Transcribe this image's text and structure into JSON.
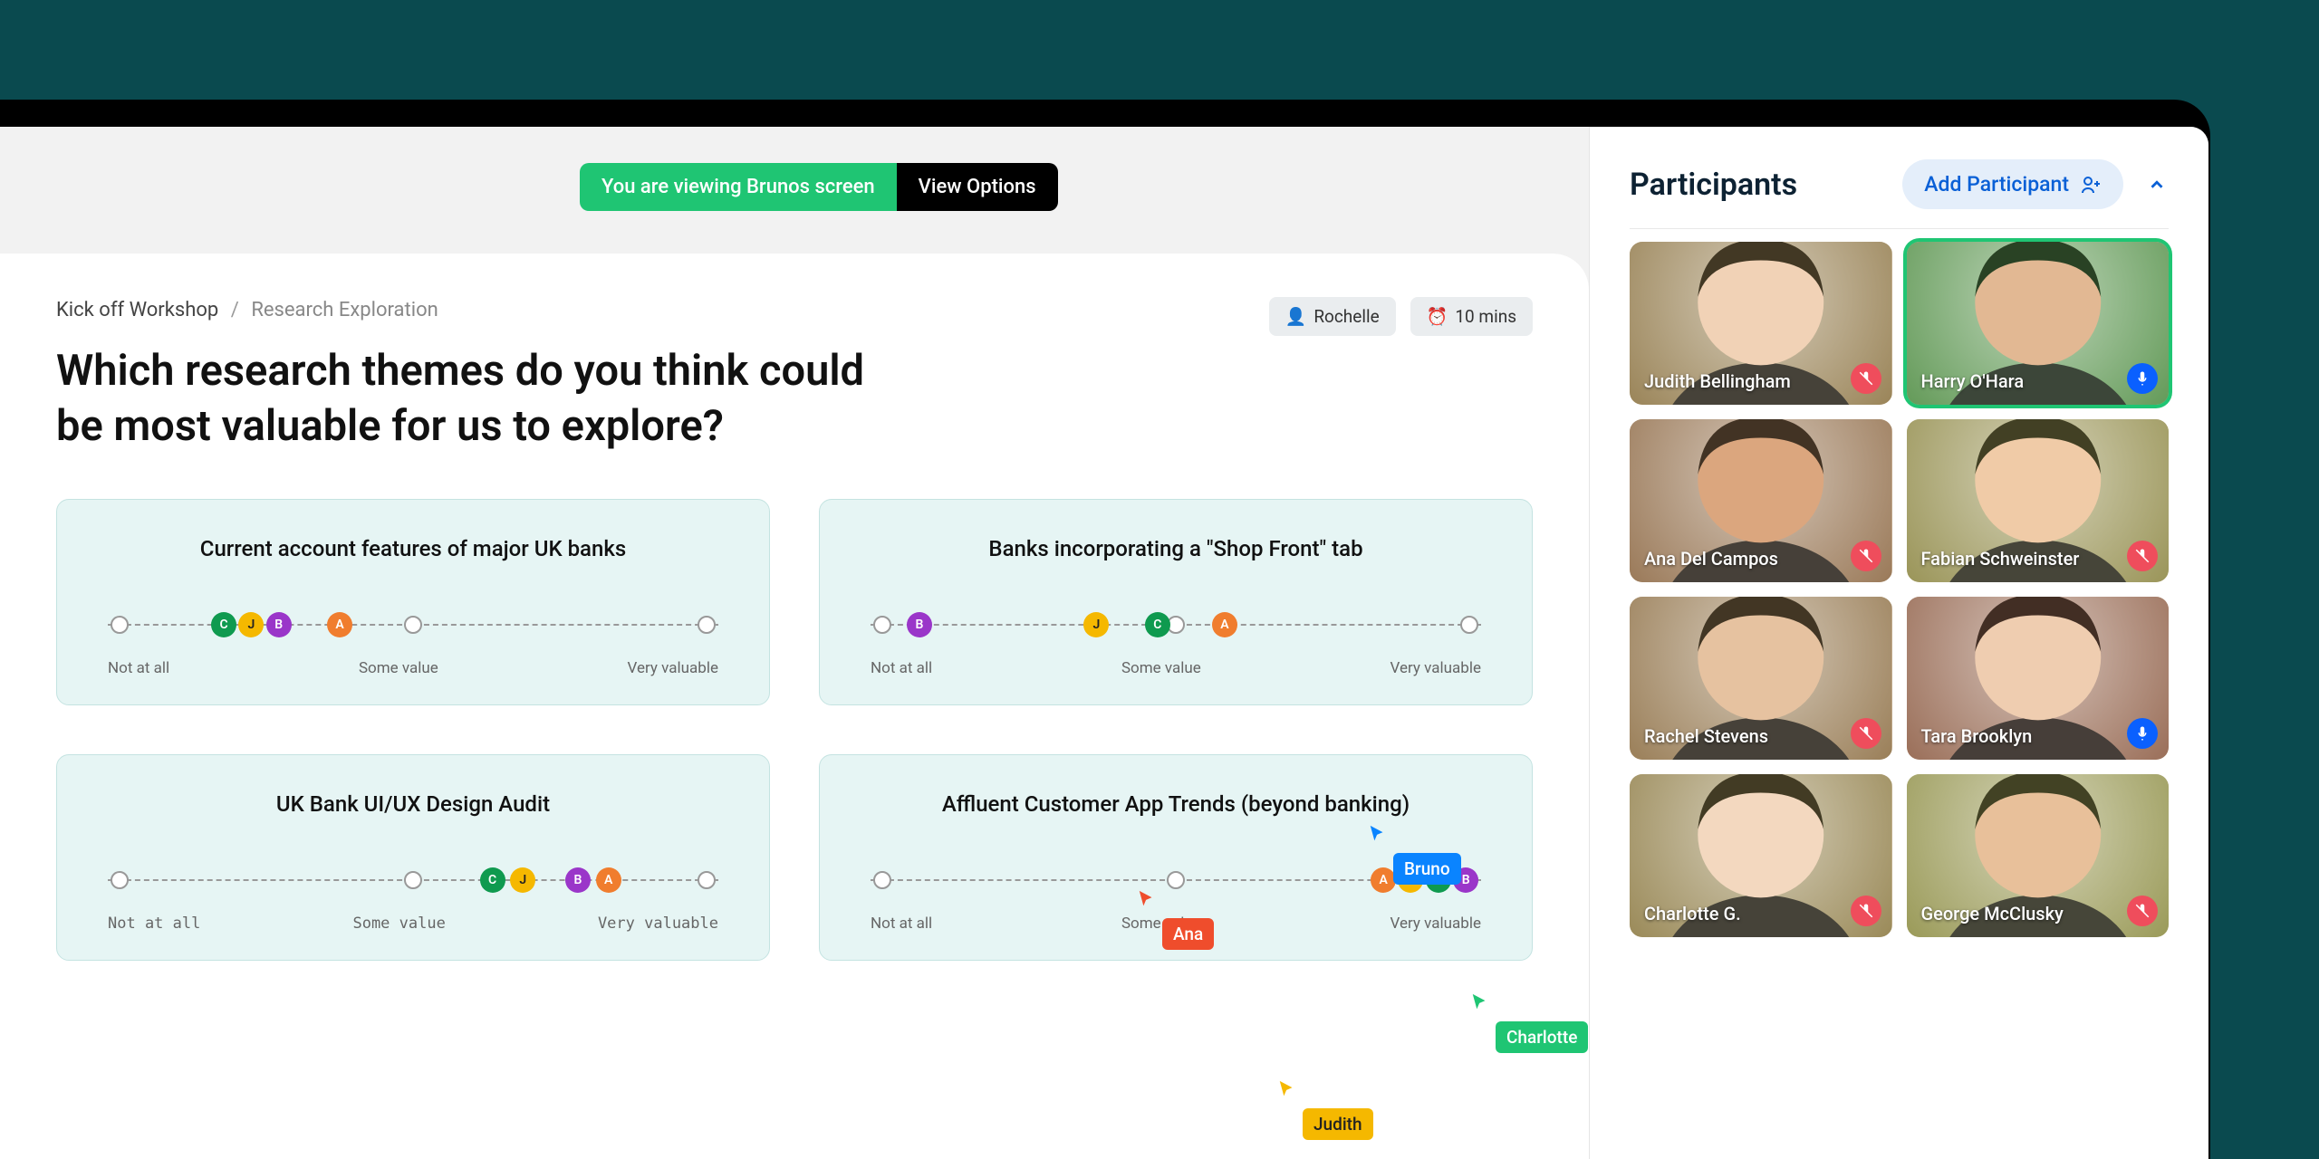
{
  "banner": {
    "viewing_text": "You are viewing Brunos screen",
    "options_label": "View Options"
  },
  "breadcrumb": {
    "parent": "Kick off Workshop",
    "current": "Research Exploration"
  },
  "meta": {
    "assignee": "Rochelle",
    "timer": "10 mins"
  },
  "page_title": "Which research themes do you think could be most valuable for us to explore?",
  "slider_label_low": "Not at all",
  "slider_label_mid": "Some value",
  "slider_label_high": "Very valuable",
  "themes": [
    {
      "title": "Current account features of major UK banks",
      "mono_labels": false,
      "dots": [
        {
          "letter": "C",
          "pos": 19
        },
        {
          "letter": "J",
          "pos": 23.5
        },
        {
          "letter": "B",
          "pos": 28
        },
        {
          "letter": "A",
          "pos": 38
        }
      ]
    },
    {
      "title": "Banks incorporating a \"Shop Front\" tab",
      "mono_labels": false,
      "dots": [
        {
          "letter": "B",
          "pos": 8
        },
        {
          "letter": "J",
          "pos": 37
        },
        {
          "letter": "C",
          "pos": 47
        },
        {
          "letter": "A",
          "pos": 58
        }
      ]
    },
    {
      "title": "UK Bank UI/UX Design Audit",
      "mono_labels": true,
      "dots": [
        {
          "letter": "C",
          "pos": 63
        },
        {
          "letter": "J",
          "pos": 68
        },
        {
          "letter": "B",
          "pos": 77
        },
        {
          "letter": "A",
          "pos": 82
        }
      ]
    },
    {
      "title": "Affluent Customer App Trends (beyond banking)",
      "mono_labels": false,
      "dots": [
        {
          "letter": "A",
          "pos": 84
        },
        {
          "letter": "J",
          "pos": 88.5
        },
        {
          "letter": "C",
          "pos": 93
        },
        {
          "letter": "B",
          "pos": 97.5
        }
      ]
    }
  ],
  "cursors": {
    "bruno": {
      "label": "Bruno"
    },
    "ana": {
      "label": "Ana"
    },
    "charlotte": {
      "label": "Charlotte"
    },
    "judith": {
      "label": "Judith"
    }
  },
  "panel": {
    "title": "Participants",
    "add_label": "Add Participant",
    "people": [
      {
        "name": "Judith Bellingham",
        "mic": "muted",
        "speaking": false,
        "hue": 40,
        "skin": "#f1d2b6"
      },
      {
        "name": "Harry O'Hara",
        "mic": "on",
        "speaking": true,
        "hue": 110,
        "skin": "#e2b893"
      },
      {
        "name": "Ana Del Campos",
        "mic": "muted",
        "speaking": false,
        "hue": 30,
        "skin": "#dba67e"
      },
      {
        "name": "Fabian Schweinster",
        "mic": "muted",
        "speaking": false,
        "hue": 55,
        "skin": "#f0cba7"
      },
      {
        "name": "Rachel Stevens",
        "mic": "muted",
        "speaking": false,
        "hue": 35,
        "skin": "#e6c2a0"
      },
      {
        "name": "Tara Brooklyn",
        "mic": "on",
        "speaking": false,
        "hue": 20,
        "skin": "#efcdb0"
      },
      {
        "name": "Charlotte G.",
        "mic": "muted",
        "speaking": false,
        "hue": 45,
        "skin": "#f3d8bf"
      },
      {
        "name": "George McClusky",
        "mic": "muted",
        "speaking": false,
        "hue": 60,
        "skin": "#e8c09a"
      }
    ]
  },
  "colors": {
    "accent_green": "#1fc573",
    "accent_blue": "#0a84ff",
    "accent_orange": "#ef4d2c",
    "accent_yellow": "#f5b800"
  }
}
